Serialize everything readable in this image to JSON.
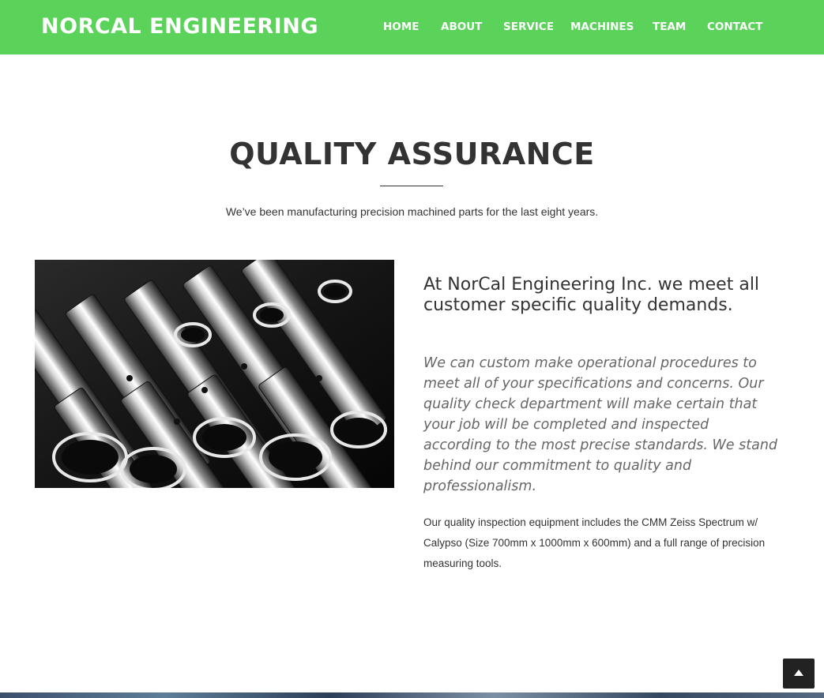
{
  "header": {
    "brand": "NORCAL ENGINEERING",
    "nav": [
      "HOME",
      "ABOUT",
      "SERVICE",
      "MACHINES",
      "TEAM",
      "CONTACT"
    ]
  },
  "section": {
    "title": "QUALITY ASSURANCE",
    "subtitle": "We’ve been manufacturing precision machined parts for the last eight years.",
    "heading": "At NorCal Engineering Inc. we meet all customer specific quality demands.",
    "quote": "We can custom make operational procedures to meet all of your specifications and concerns. Our quality check department will make certain that your job will be completed and inspected according to the most precise standards. We stand behind our commitment to quality and professionalism.",
    "details": "Our quality inspection equipment includes the CMM Zeiss Spectrum w/ Calypso (Size 700mm x 1000mm x 600mm) and a full range of precision measuring tools."
  },
  "colors": {
    "navbar": "#5bd35b",
    "text": "#333333",
    "quote_text": "#666666",
    "back_to_top": "#222222"
  },
  "icons": {
    "back_to_top": "chevron-up-icon"
  }
}
